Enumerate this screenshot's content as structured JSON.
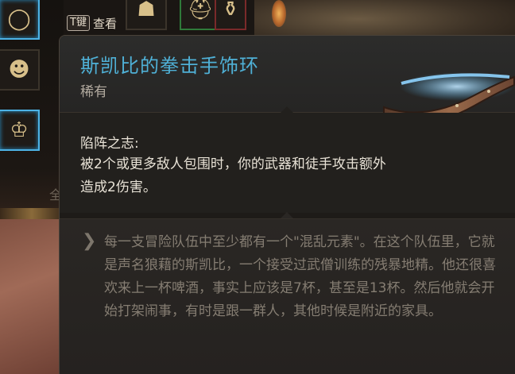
{
  "key_hint": {
    "key": "T键",
    "label": "查看"
  },
  "left_strip": {
    "partial_text": "全"
  },
  "inventory": {
    "slots": [
      {
        "icon": "belt-icon",
        "glyph": "◯",
        "state": "selected"
      },
      {
        "icon": "mask-icon",
        "glyph": "☻",
        "state": "normal"
      },
      {
        "icon": "circlet-icon",
        "glyph": "♔",
        "state": "selected"
      },
      {
        "icon": "helmet-icon",
        "glyph": "☗",
        "state": "normal"
      },
      {
        "icon": "hat-icon",
        "glyph": "⛑",
        "state": "green"
      },
      {
        "icon": "potion-icon",
        "glyph": "⚱",
        "state": "red"
      }
    ]
  },
  "tooltip": {
    "item_name": "斯凯比的拳击手饰环",
    "rarity": "稀有",
    "ability_title": "陷阵之志:",
    "ability_desc": "被2个或更多敌人包围时，你的武器和徒手攻击额外造成2伤害。",
    "flavor_text": "每一支冒险队伍中至少都有一个\"混乱元素\"。在这个队伍里，它就是声名狼藉的斯凯比，一个接受过武僧训练的残暴地精。他还很喜欢来上一杯啤酒，事实上应该是7杯，甚至是13杯。然后他就会开始打架闹事，有时是跟一群人，其他时候是附近的家具。"
  },
  "colors": {
    "item_name": "#4fb0d6",
    "rarity": "#b3aba0",
    "body_text": "#e8e2d6",
    "flavor_text": "#857d72",
    "selected_slot_border": "#4db3e6"
  }
}
